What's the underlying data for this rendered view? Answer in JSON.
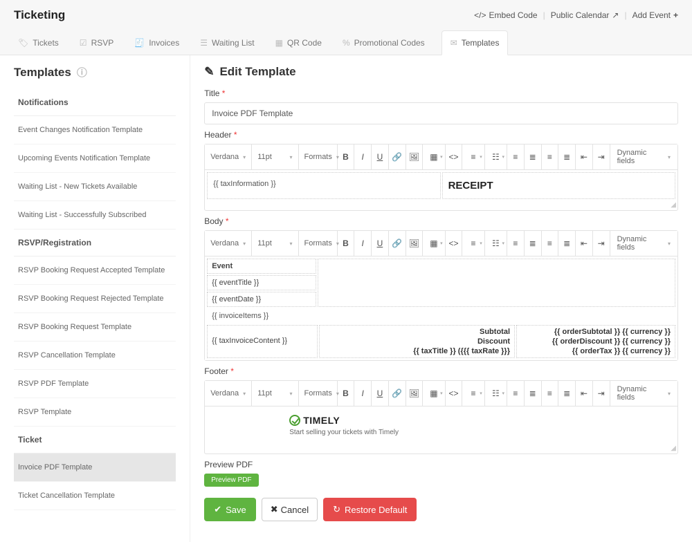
{
  "header": {
    "title": "Ticketing",
    "links": {
      "embed": "Embed Code",
      "calendar": "Public Calendar",
      "add": "Add Event"
    }
  },
  "tabs": [
    "Tickets",
    "RSVP",
    "Invoices",
    "Waiting List",
    "QR Code",
    "Promotional Codes",
    "Templates"
  ],
  "sidebar": {
    "title": "Templates",
    "groups": [
      {
        "head": "Notifications",
        "items": [
          "Event Changes Notification Template",
          "Upcoming Events Notification Template",
          "Waiting List - New Tickets Available",
          "Waiting List - Successfully Subscribed"
        ]
      },
      {
        "head": "RSVP/Registration",
        "items": [
          "RSVP Booking Request Accepted Template",
          "RSVP Booking Request Rejected Template",
          "RSVP Booking Request Template",
          "RSVP Cancellation Template",
          "RSVP PDF Template",
          "RSVP Template"
        ]
      },
      {
        "head": "Ticket",
        "items": [
          "Invoice PDF Template",
          "Ticket Cancellation Template"
        ],
        "activeIndex": 0
      }
    ]
  },
  "edit": {
    "title": "Edit Template",
    "title_label": "Title",
    "title_value": "Invoice PDF Template",
    "header_label": "Header",
    "body_label": "Body",
    "footer_label": "Footer",
    "preview_label": "Preview PDF",
    "preview_btn": "Preview PDF",
    "save": "Save",
    "cancel": "Cancel",
    "restore": "Restore Default"
  },
  "toolbar": {
    "font": "Verdana",
    "size": "11pt",
    "formats": "Formats",
    "dynamic": "Dynamic fields"
  },
  "headerEditor": {
    "left": "{{ taxInformation }}",
    "right": "RECEIPT"
  },
  "bodyEditor": {
    "eventHead": "Event",
    "eventTitle": "{{ eventTitle }}",
    "eventDate": "{{ eventDate }}",
    "invoiceItems": "{{ invoiceItems }}",
    "taxInvoice": "{{ taxInvoiceContent }}",
    "summaryLabels": {
      "subtotal": "Subtotal",
      "discount": "Discount",
      "taxLine": "{{ taxTitle }} ({{{ taxRate }}}"
    },
    "summaryValues": {
      "subtotal": "{{ orderSubtotal }} {{ currency }}",
      "discount": "{{ orderDiscount }} {{ currency }}",
      "tax": "{{ orderTax }} {{ currency }}"
    }
  },
  "footerEditor": {
    "brand": "TIMELY",
    "caption": "Start selling your tickets with Timely"
  }
}
